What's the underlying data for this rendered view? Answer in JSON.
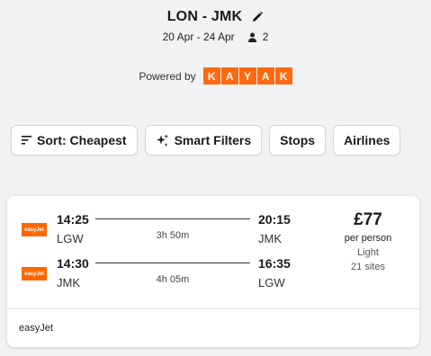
{
  "header": {
    "route": "LON - JMK",
    "dates": "20 Apr - 24 Apr",
    "passengers": "2"
  },
  "powered": {
    "label": "Powered by",
    "logo_letters": [
      "K",
      "A",
      "Y",
      "A",
      "K"
    ]
  },
  "filters": {
    "sort_label": "Sort: Cheapest",
    "smart_label": "Smart Filters",
    "stops_label": "Stops",
    "airlines_label": "Airlines"
  },
  "result": {
    "outbound": {
      "airline_logo_text": "easyJet",
      "depart_time": "14:25",
      "depart_code": "LGW",
      "duration": "3h 50m",
      "arrive_time": "20:15",
      "arrive_code": "JMK"
    },
    "inbound": {
      "airline_logo_text": "easyJet",
      "depart_time": "14:30",
      "depart_code": "JMK",
      "duration": "4h 05m",
      "arrive_time": "16:35",
      "arrive_code": "LGW"
    },
    "price": "£77",
    "price_unit": "per person",
    "fare_type": "Light",
    "sites": "21 sites",
    "operator": "easyJet"
  },
  "colors": {
    "kayak_orange": "#ff690f",
    "easyjet_orange": "#ff6600",
    "background": "#f1f2f4"
  },
  "icons": {
    "edit": "pencil-icon",
    "passenger": "person-icon",
    "sort": "sort-lines-icon",
    "smart": "sparkle-icon"
  }
}
